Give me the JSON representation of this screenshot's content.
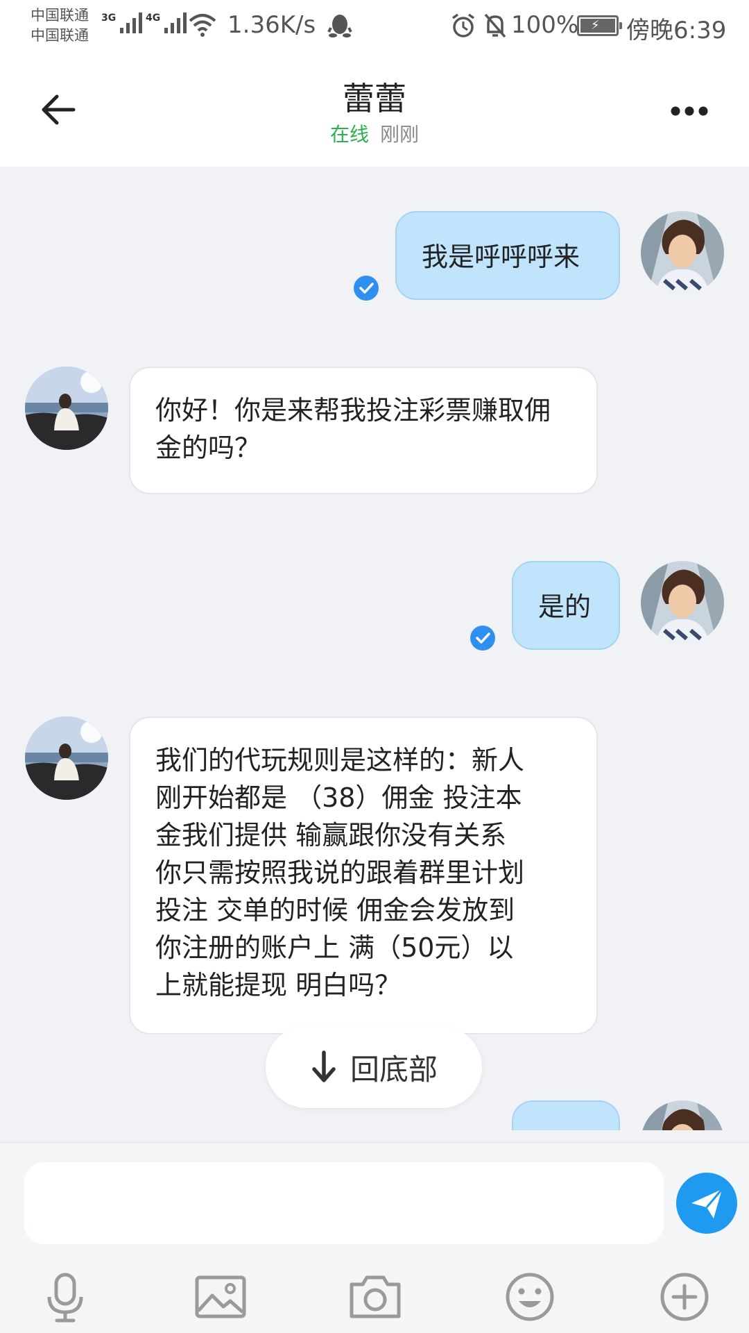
{
  "status_bar": {
    "carrier_1": "中国联通",
    "carrier_2": "中国联通",
    "net_1": "3G",
    "net_2": "4G",
    "speed": "1.36K/s",
    "battery": "100%",
    "time": "傍晚6:39",
    "icons": [
      "signal-icon",
      "wifi-icon",
      "qq-icon",
      "alarm-icon",
      "mute-icon",
      "battery-icon"
    ]
  },
  "header": {
    "title": "蕾蕾",
    "online_label": "在线",
    "last_seen": "刚刚",
    "back_icon": "back-arrow-icon",
    "more_icon": "more-dots-icon"
  },
  "messages": [
    {
      "direction": "out",
      "text": "我是呼呼呼来",
      "read": true
    },
    {
      "direction": "in",
      "text": "你好！你是来帮我投注彩票赚取佣金的吗？"
    },
    {
      "direction": "out",
      "text": "是的",
      "read": true
    },
    {
      "direction": "in",
      "lines": [
        "我们的代玩规则是这样的：新人",
        "刚开始都是 （38）佣金 投注本",
        "金我们提供 输赢跟你没有关系",
        "你只需按照我说的跟着群里计划",
        "投注 交单的时候 佣金会发放到",
        "你注册的账户上  满（50元）以",
        "上就能提现 明白吗？"
      ]
    }
  ],
  "scroll_to_bottom": {
    "label": "回底部",
    "icon": "arrow-down-icon"
  },
  "composer": {
    "placeholder": "",
    "send_icon": "send-icon",
    "tools": [
      "mic-icon",
      "image-icon",
      "camera-icon",
      "emoji-icon",
      "plus-icon"
    ]
  },
  "colors": {
    "outgoing_bubble": "#bfe4fb",
    "incoming_bubble": "#ffffff",
    "online": "#2bb24c",
    "accent": "#1e9bf0",
    "chat_bg": "#f1f2f6"
  }
}
